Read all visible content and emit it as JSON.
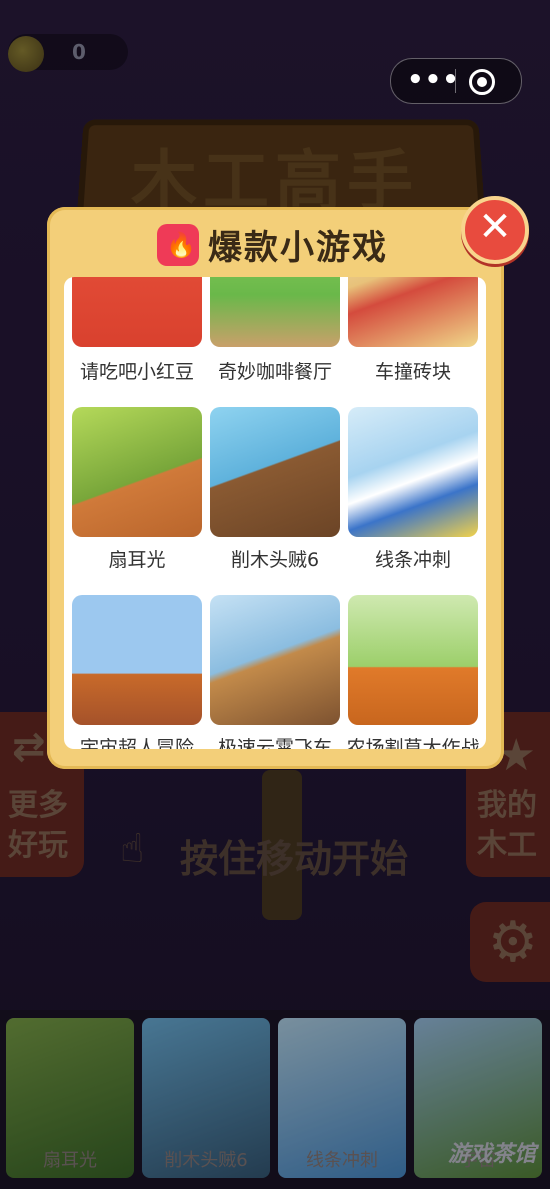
{
  "coins": {
    "value": "0"
  },
  "capsule": {
    "more_icon": "more-dots-icon",
    "close_icon": "target-icon"
  },
  "game_title": "木工高手",
  "modal": {
    "title": "爆款小游戏",
    "title_icon": "flame-icon",
    "close_icon": "close-icon",
    "games": [
      {
        "label": "请吃吧小红豆"
      },
      {
        "label": "奇妙咖啡餐厅"
      },
      {
        "label": "车撞砖块"
      },
      {
        "label": "扇耳光"
      },
      {
        "label": "削木头贼6"
      },
      {
        "label": "线条冲刺"
      },
      {
        "label": "宇宙超人冒险"
      },
      {
        "label": "极速云霄飞车"
      },
      {
        "label": "农场割草大作战"
      }
    ]
  },
  "side_left": {
    "label": "更多好玩",
    "icon": "swap-arrows-icon"
  },
  "side_right": {
    "label": "我的木工",
    "icon": "star-icon"
  },
  "settings": {
    "icon": "gear-icon"
  },
  "hint": {
    "text": "按住移动开始",
    "icon": "hand-pointer-icon"
  },
  "bottom_games": [
    {
      "label": "扇耳光"
    },
    {
      "label": "削木头贼6"
    },
    {
      "label": "线条冲刺"
    },
    {
      "label": "宇宙"
    }
  ],
  "watermark": "游戏茶馆",
  "colors": {
    "modal_bg": "#f3cf79",
    "close_red": "#e84b3e",
    "title_icon_red": "#ef3a57",
    "bg_purple": "#2a1b3d"
  }
}
